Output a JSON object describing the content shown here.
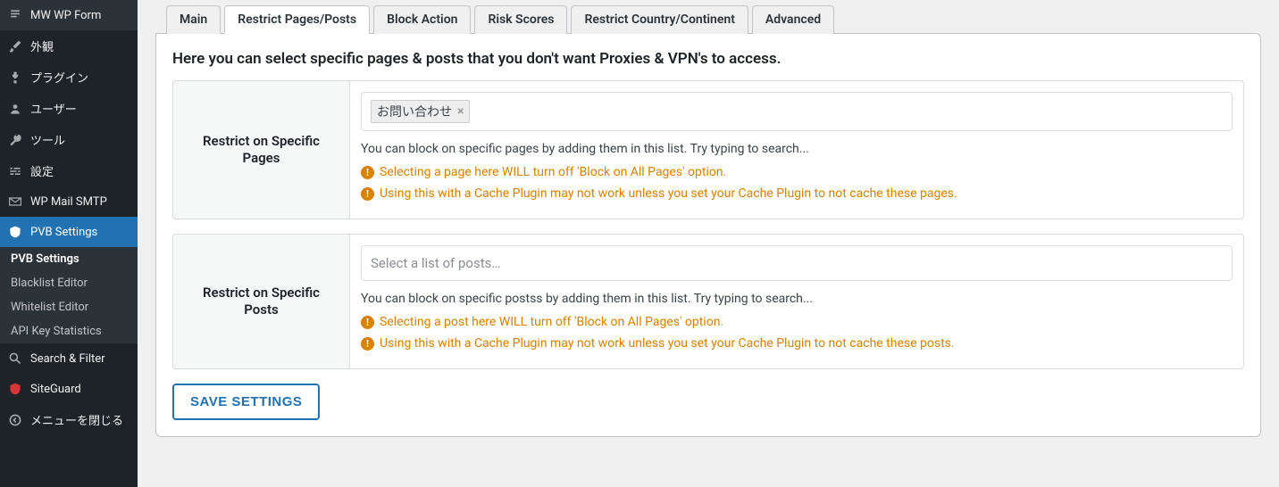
{
  "sidebar": {
    "items": [
      {
        "icon": "form-icon",
        "label": "MW WP Form"
      },
      {
        "icon": "brush-icon",
        "label": "外観"
      },
      {
        "icon": "plug-icon",
        "label": "プラグイン"
      },
      {
        "icon": "user-icon",
        "label": "ユーザー"
      },
      {
        "icon": "wrench-icon",
        "label": "ツール"
      },
      {
        "icon": "sliders-icon",
        "label": "設定"
      },
      {
        "icon": "mail-icon",
        "label": "WP Mail SMTP"
      },
      {
        "icon": "shield-icon",
        "label": "PVB Settings",
        "active": true
      }
    ],
    "sub": [
      {
        "label": "PVB Settings",
        "current": true
      },
      {
        "label": "Blacklist Editor"
      },
      {
        "label": "Whitelist Editor"
      },
      {
        "label": "API Key Statistics"
      }
    ],
    "footer": [
      {
        "icon": "search-icon",
        "label": "Search & Filter"
      },
      {
        "icon": "siteguard-icon",
        "label": "SiteGuard"
      },
      {
        "icon": "collapse-icon",
        "label": "メニューを閉じる"
      }
    ]
  },
  "tabs": [
    {
      "label": "Main"
    },
    {
      "label": "Restrict Pages/Posts",
      "active": true
    },
    {
      "label": "Block Action"
    },
    {
      "label": "Risk Scores"
    },
    {
      "label": "Restrict Country/Continent"
    },
    {
      "label": "Advanced"
    }
  ],
  "intro": "Here you can select specific pages & posts that you don't want Proxies & VPN's to access.",
  "pages_section": {
    "label": "Restrict on Specific Pages",
    "chip_text": "お問い合わせ",
    "desc": "You can block on specific pages by adding them in this list. Try typing to search...",
    "warn1": "Selecting a page here WILL turn off 'Block on All Pages' option.",
    "warn2": "Using this with a Cache Plugin may not work unless you set your Cache Plugin to not cache these pages."
  },
  "posts_section": {
    "label": "Restrict on Specific Posts",
    "placeholder": "Select a list of posts…",
    "desc": "You can block on specific postss by adding them in this list. Try typing to search...",
    "warn1": "Selecting a post here WILL turn off 'Block on All Pages' option.",
    "warn2": "Using this with a Cache Plugin may not work unless you set your Cache Plugin to not cache these posts."
  },
  "save_label": "SAVE SETTINGS"
}
